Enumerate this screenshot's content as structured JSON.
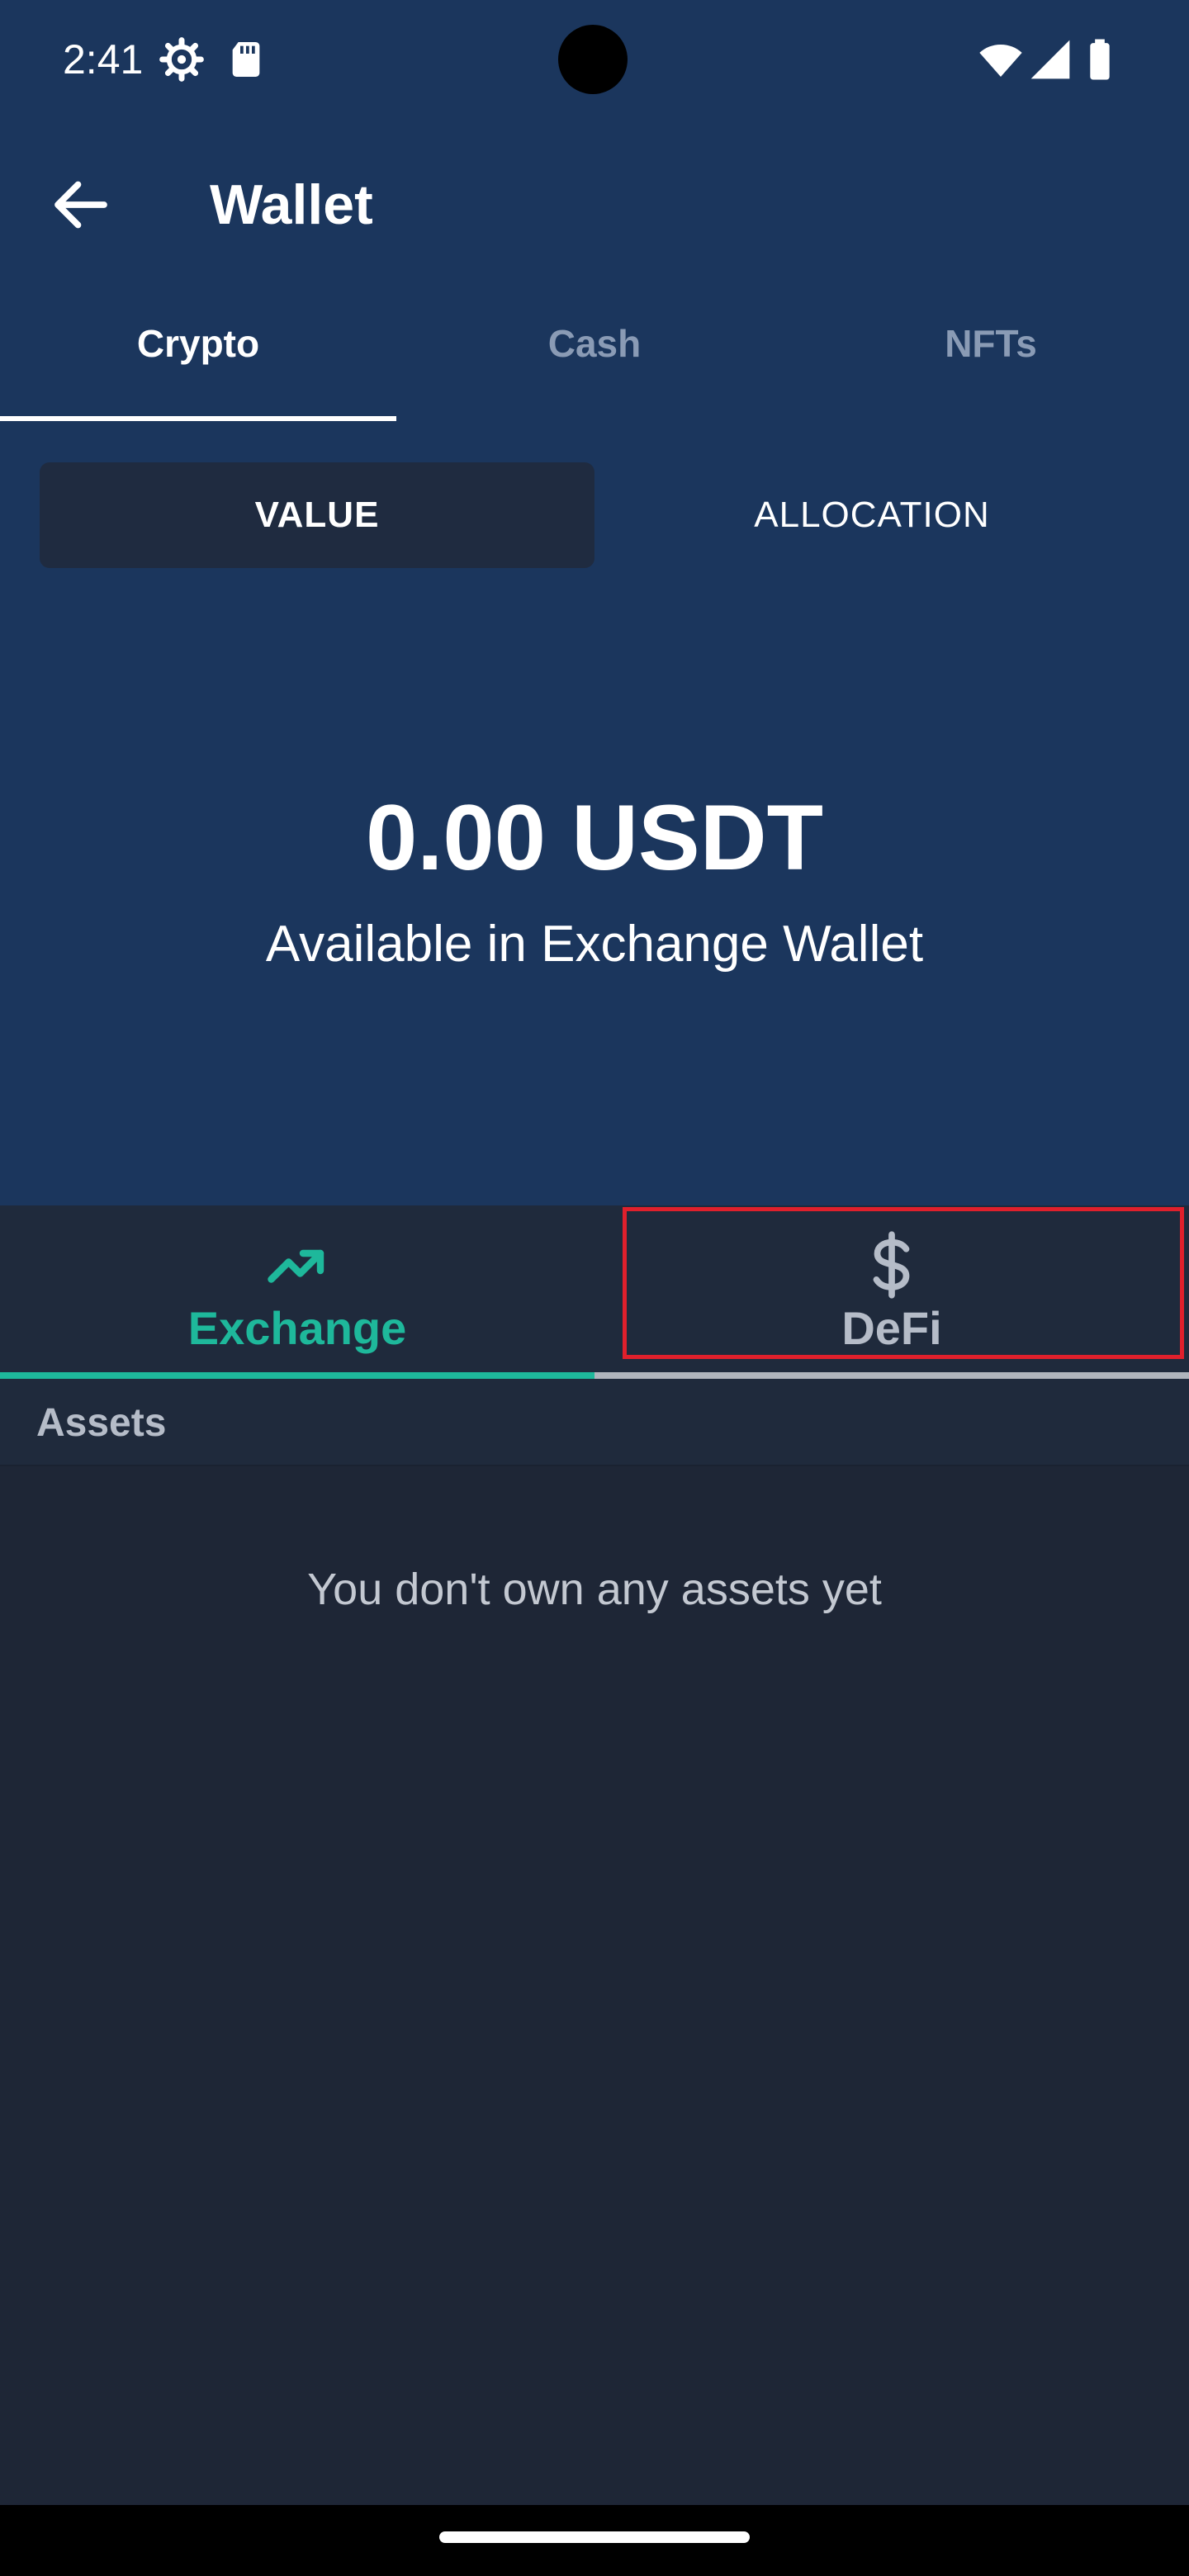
{
  "status_bar": {
    "time": "2:41",
    "icons": [
      "settings-gear-icon",
      "sd-card-icon",
      "wifi-icon",
      "cell-signal-icon",
      "battery-icon"
    ]
  },
  "app_bar": {
    "title": "Wallet",
    "back_icon": "arrow-left-icon"
  },
  "top_tabs": [
    {
      "label": "Crypto",
      "active": true
    },
    {
      "label": "Cash",
      "active": false
    },
    {
      "label": "NFTs",
      "active": false
    }
  ],
  "view_toggle": {
    "value_label": "VALUE",
    "allocation_label": "ALLOCATION",
    "selected": "VALUE"
  },
  "balance": {
    "amount": "0.00 USDT",
    "subtitle": "Available in Exchange Wallet"
  },
  "wallet_tabs": [
    {
      "label": "Exchange",
      "icon": "trending-up-icon",
      "active": true
    },
    {
      "label": "DeFi",
      "icon": "dollar-sign-icon",
      "active": false
    }
  ],
  "assets": {
    "header": "Assets",
    "empty_message": "You don't own any assets yet"
  },
  "colors": {
    "header_bg": "#1b365d",
    "content_bg": "#1e2636",
    "accent": "#1eb89b",
    "highlight": "#e0202c"
  }
}
